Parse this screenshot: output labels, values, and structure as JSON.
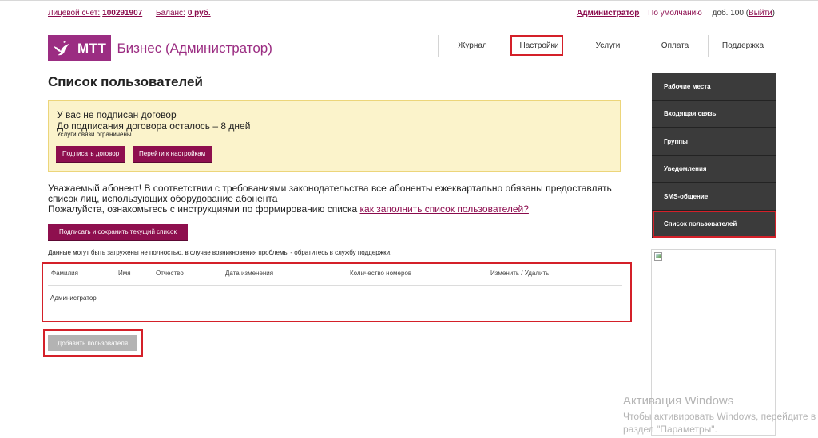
{
  "topbar": {
    "account_label": "Лицевой счет:",
    "account_number": "100291907",
    "balance_label": "Баланс:",
    "balance_value": "0 руб.",
    "admin": "Администратор",
    "default": "По умолчанию",
    "ext": "доб. 100",
    "exit_open": "(",
    "exit": "Выйти",
    "exit_close": ")"
  },
  "logo": {
    "brand": "МТТ",
    "title": "Бизнес (Администратор)"
  },
  "nav": {
    "items": [
      "Журнал",
      "Настройки",
      "Услуги",
      "Оплата",
      "Поддержка"
    ],
    "active": "Настройки"
  },
  "page": {
    "title": "Список пользователей"
  },
  "warning": {
    "line1": "У вас не подписан договор",
    "line2": "До подписания договора осталось – 8 дней",
    "line3": "Услуги связи ограничены",
    "sign_button": "Подписать договор",
    "settings_button": "Перейти к настройкам"
  },
  "info": {
    "text1": "Уважаемый абонент! В соответствии с требованиями законодательства все абоненты ежеквартально обязаны предоставлять список лиц, использующих оборудование абонента",
    "text2": "Пожалуйста, ознакомьтесь с инструкциями по формированию списка",
    "link": "как заполнить список пользователей?",
    "sign_save_button": "Подписать и сохранить текущий список",
    "note": "Данные могут быть загружены не полностью, в случае возникновения проблемы - обратитесь в службу поддержки."
  },
  "table": {
    "headers": [
      "Фамилия",
      "Имя",
      "Отчество",
      "Дата изменения",
      "Количество номеров",
      "Изменить / Удалить"
    ],
    "rows": [
      [
        "Администратор",
        "",
        "",
        "",
        "",
        ""
      ]
    ]
  },
  "add_user_button": "Добавить пользователя",
  "sidebar": {
    "items": [
      "Рабочие места",
      "Входящая связь",
      "Группы",
      "Уведомления",
      "SMS-общение",
      "Список пользователей"
    ],
    "active": "Список пользователей"
  },
  "watermark": {
    "line1": "Активация Windows",
    "line2": "Чтобы активировать Windows, перейдите в",
    "line3": "раздел \"Параметры\"."
  },
  "colors": {
    "brand": "#9b2d82",
    "button": "#8e0f4e",
    "highlight": "#d42029",
    "sidebar": "#3b3b3b",
    "warning_bg": "#fbf3cb"
  }
}
